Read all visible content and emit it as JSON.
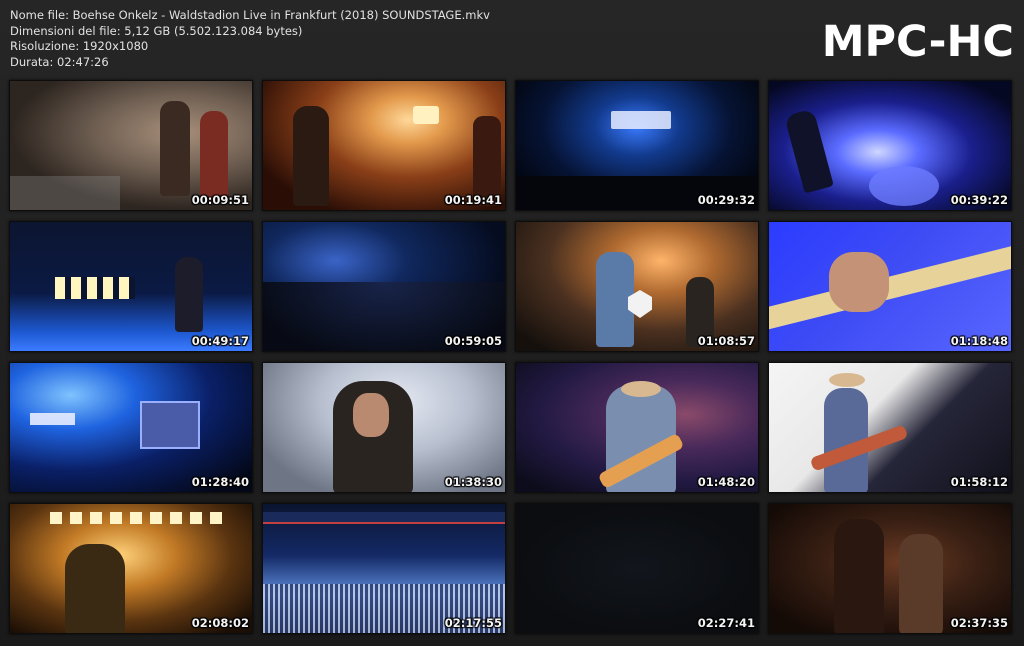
{
  "file_info": {
    "name": "Nome file: Boehse Onkelz - Waldstadion Live in Frankfurt (2018) SOUNDSTAGE.mkv",
    "size": "Dimensioni del file: 5,12 GB (5.502.123.084 bytes)",
    "resolution": "Risoluzione: 1920x1080",
    "duration": "Durata: 02:47:26"
  },
  "brand": "MPC-HC",
  "thumbnails": [
    {
      "timestamp": "00:09:51"
    },
    {
      "timestamp": "00:19:41"
    },
    {
      "timestamp": "00:29:32"
    },
    {
      "timestamp": "00:39:22"
    },
    {
      "timestamp": "00:49:17"
    },
    {
      "timestamp": "00:59:05"
    },
    {
      "timestamp": "01:08:57"
    },
    {
      "timestamp": "01:18:48"
    },
    {
      "timestamp": "01:28:40"
    },
    {
      "timestamp": "01:38:30"
    },
    {
      "timestamp": "01:48:20"
    },
    {
      "timestamp": "01:58:12"
    },
    {
      "timestamp": "02:08:02"
    },
    {
      "timestamp": "02:17:55"
    },
    {
      "timestamp": "02:27:41"
    },
    {
      "timestamp": "02:37:35"
    }
  ]
}
